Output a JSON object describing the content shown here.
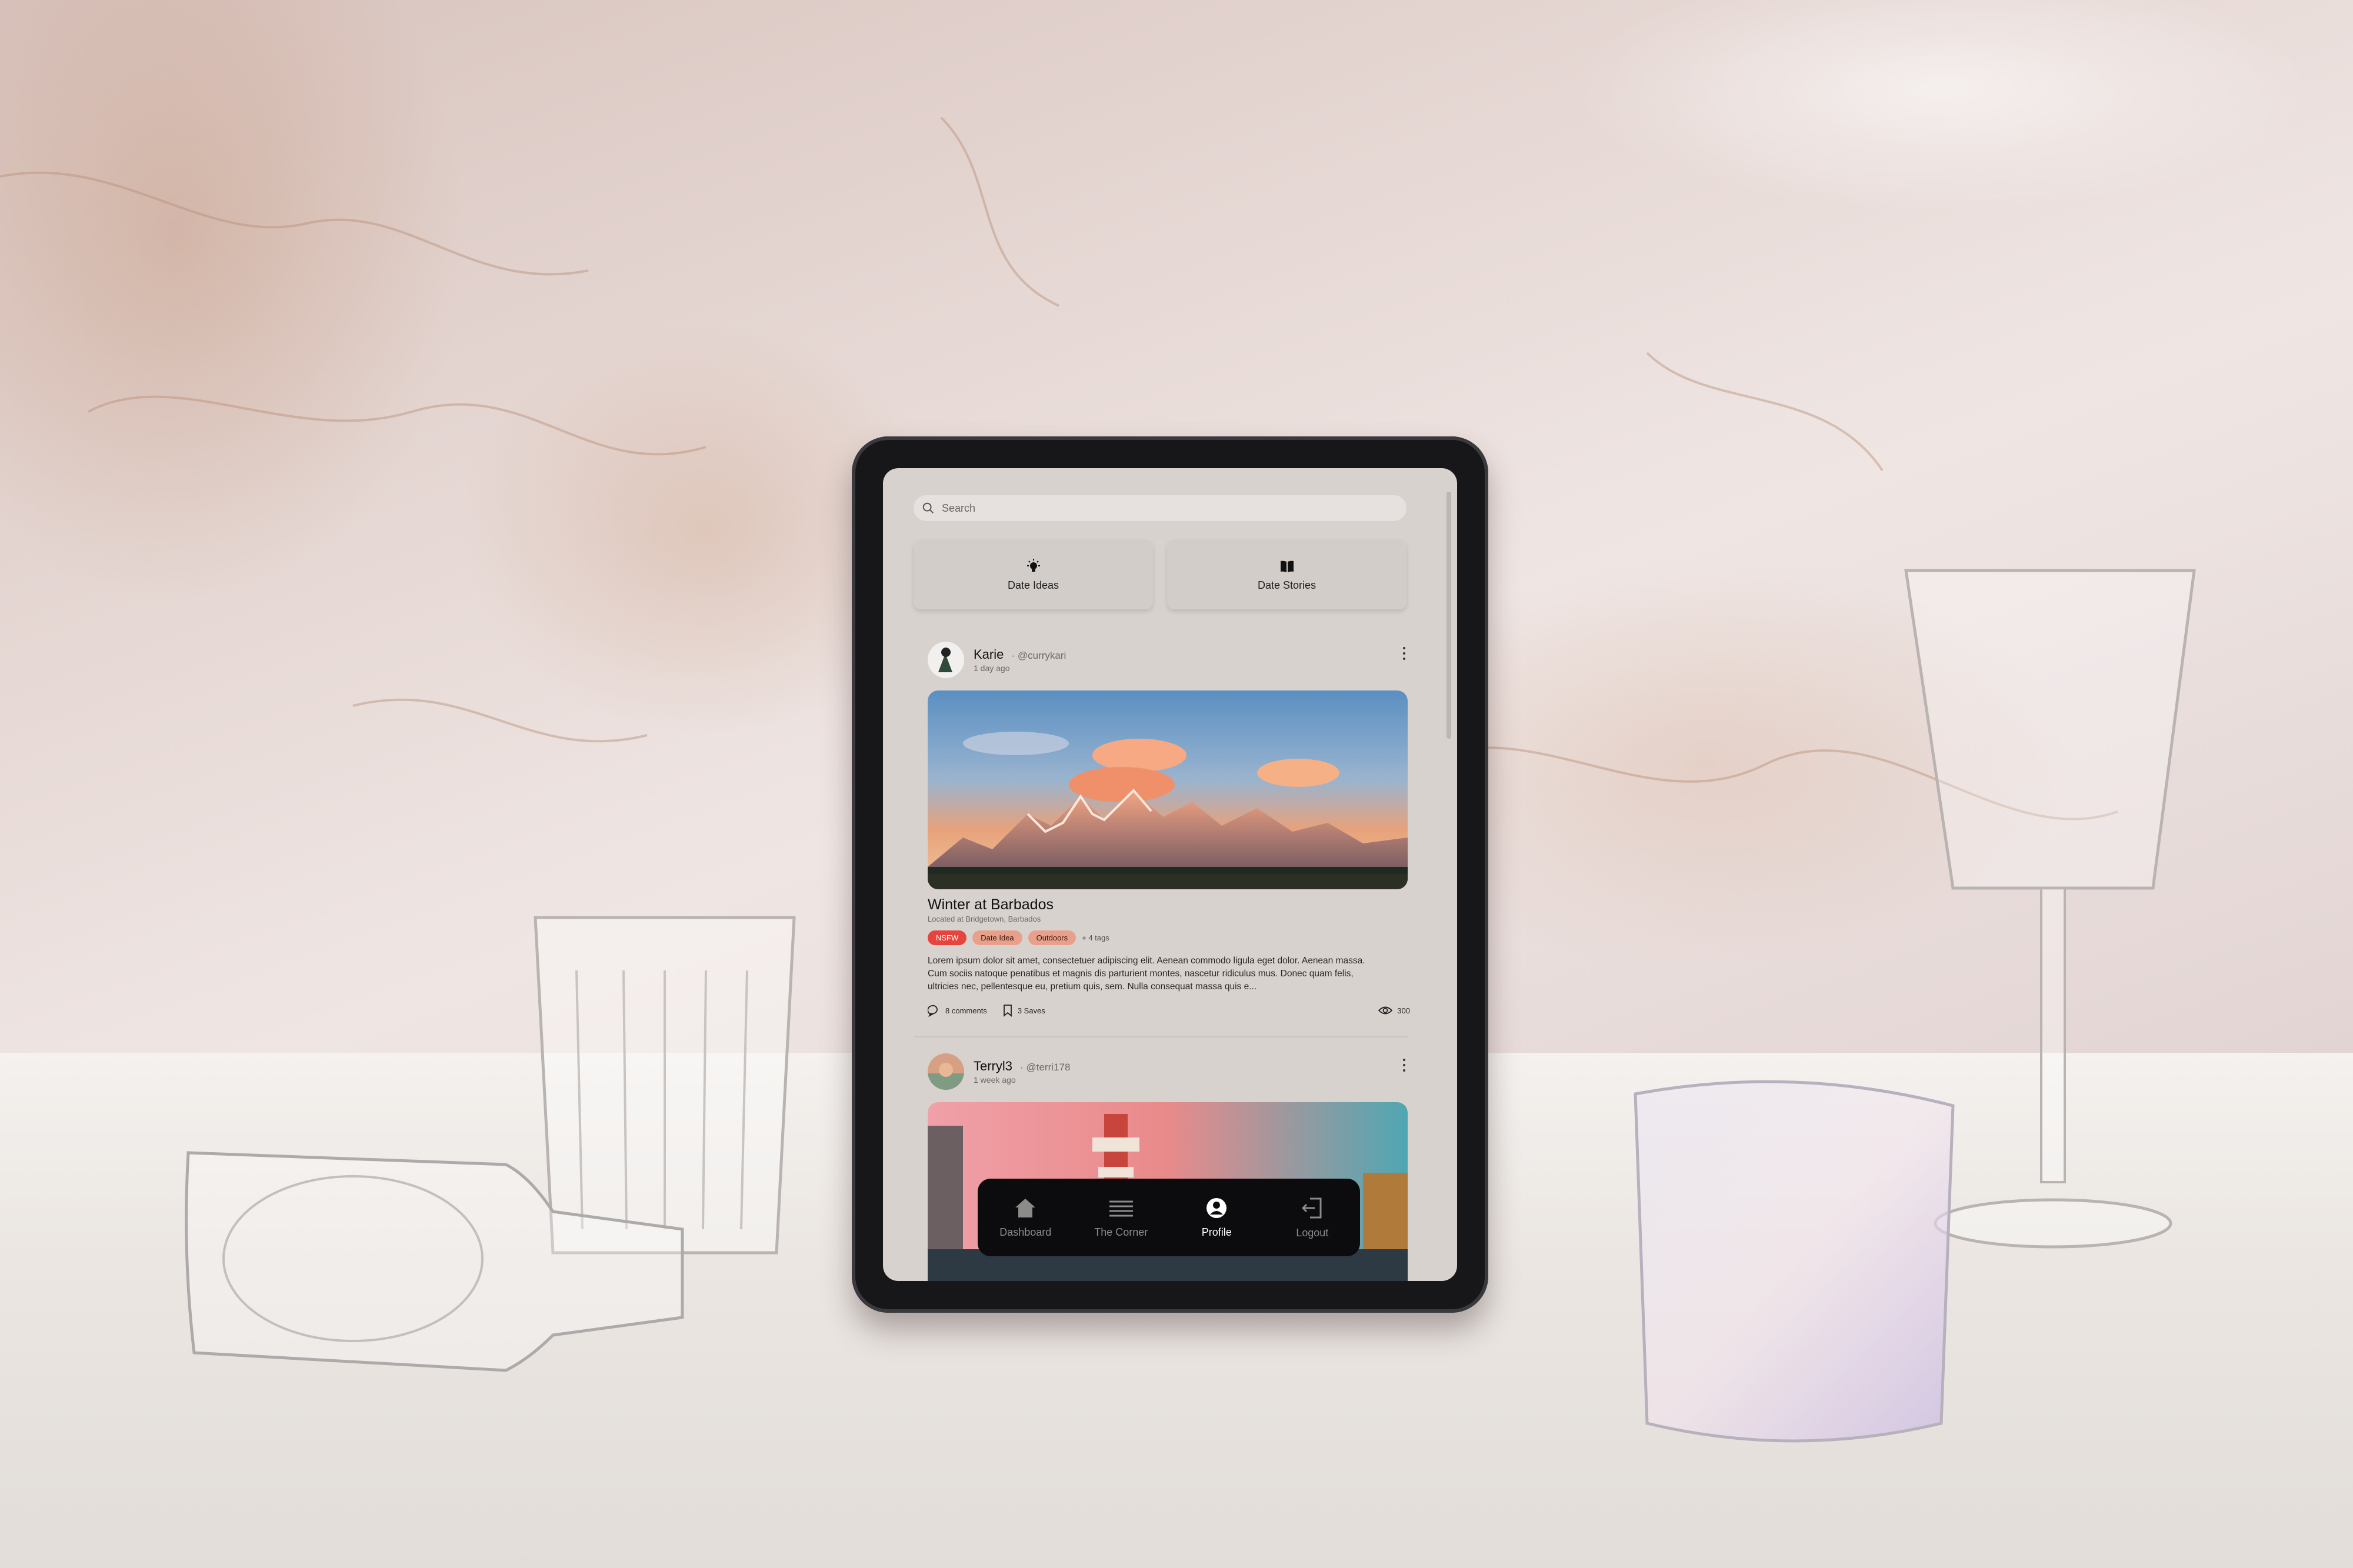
{
  "search": {
    "placeholder": "Search",
    "icon": "search-icon"
  },
  "quick_actions": [
    {
      "label": "Date Ideas",
      "icon": "lightbulb-icon"
    },
    {
      "label": "Date Stories",
      "icon": "book-icon"
    }
  ],
  "posts": [
    {
      "author": "Karie",
      "handle": "@currykari",
      "time": "1 day ago",
      "title": "Winter at Barbados",
      "location": "Located at Bridgetown, Barbados",
      "tags": [
        "NSFW",
        "Date Idea",
        "Outdoors"
      ],
      "more_tags": "+ 4 tags",
      "body": "Lorem ipsum dolor sit amet, consectetuer adipiscing elit. Aenean commodo ligula eget dolor. Aenean massa. Cum sociis natoque penatibus et magnis dis parturient montes, nascetur ridiculus mus. Donec quam felis, ultricies nec, pellentesque eu, pretium quis, sem. Nulla consequat massa quis e...",
      "comments": "8 comments",
      "saves": "3 Saves",
      "views": "300"
    },
    {
      "author": "Terryl3",
      "handle": "@terri178",
      "time": "1 week ago"
    }
  ],
  "nav": [
    {
      "label": "Dashboard",
      "icon": "home-icon",
      "active": false
    },
    {
      "label": "The Corner",
      "icon": "menu-lines-icon",
      "active": false
    },
    {
      "label": "Profile",
      "icon": "profile-icon",
      "active": true
    },
    {
      "label": "Logout",
      "icon": "logout-icon",
      "active": false
    }
  ],
  "colors": {
    "screen_bg": "#d8d2cf",
    "nav_bg": "#0c0c0e",
    "tag_red": "#e8443e",
    "tag_peach": "#e9a08a"
  }
}
